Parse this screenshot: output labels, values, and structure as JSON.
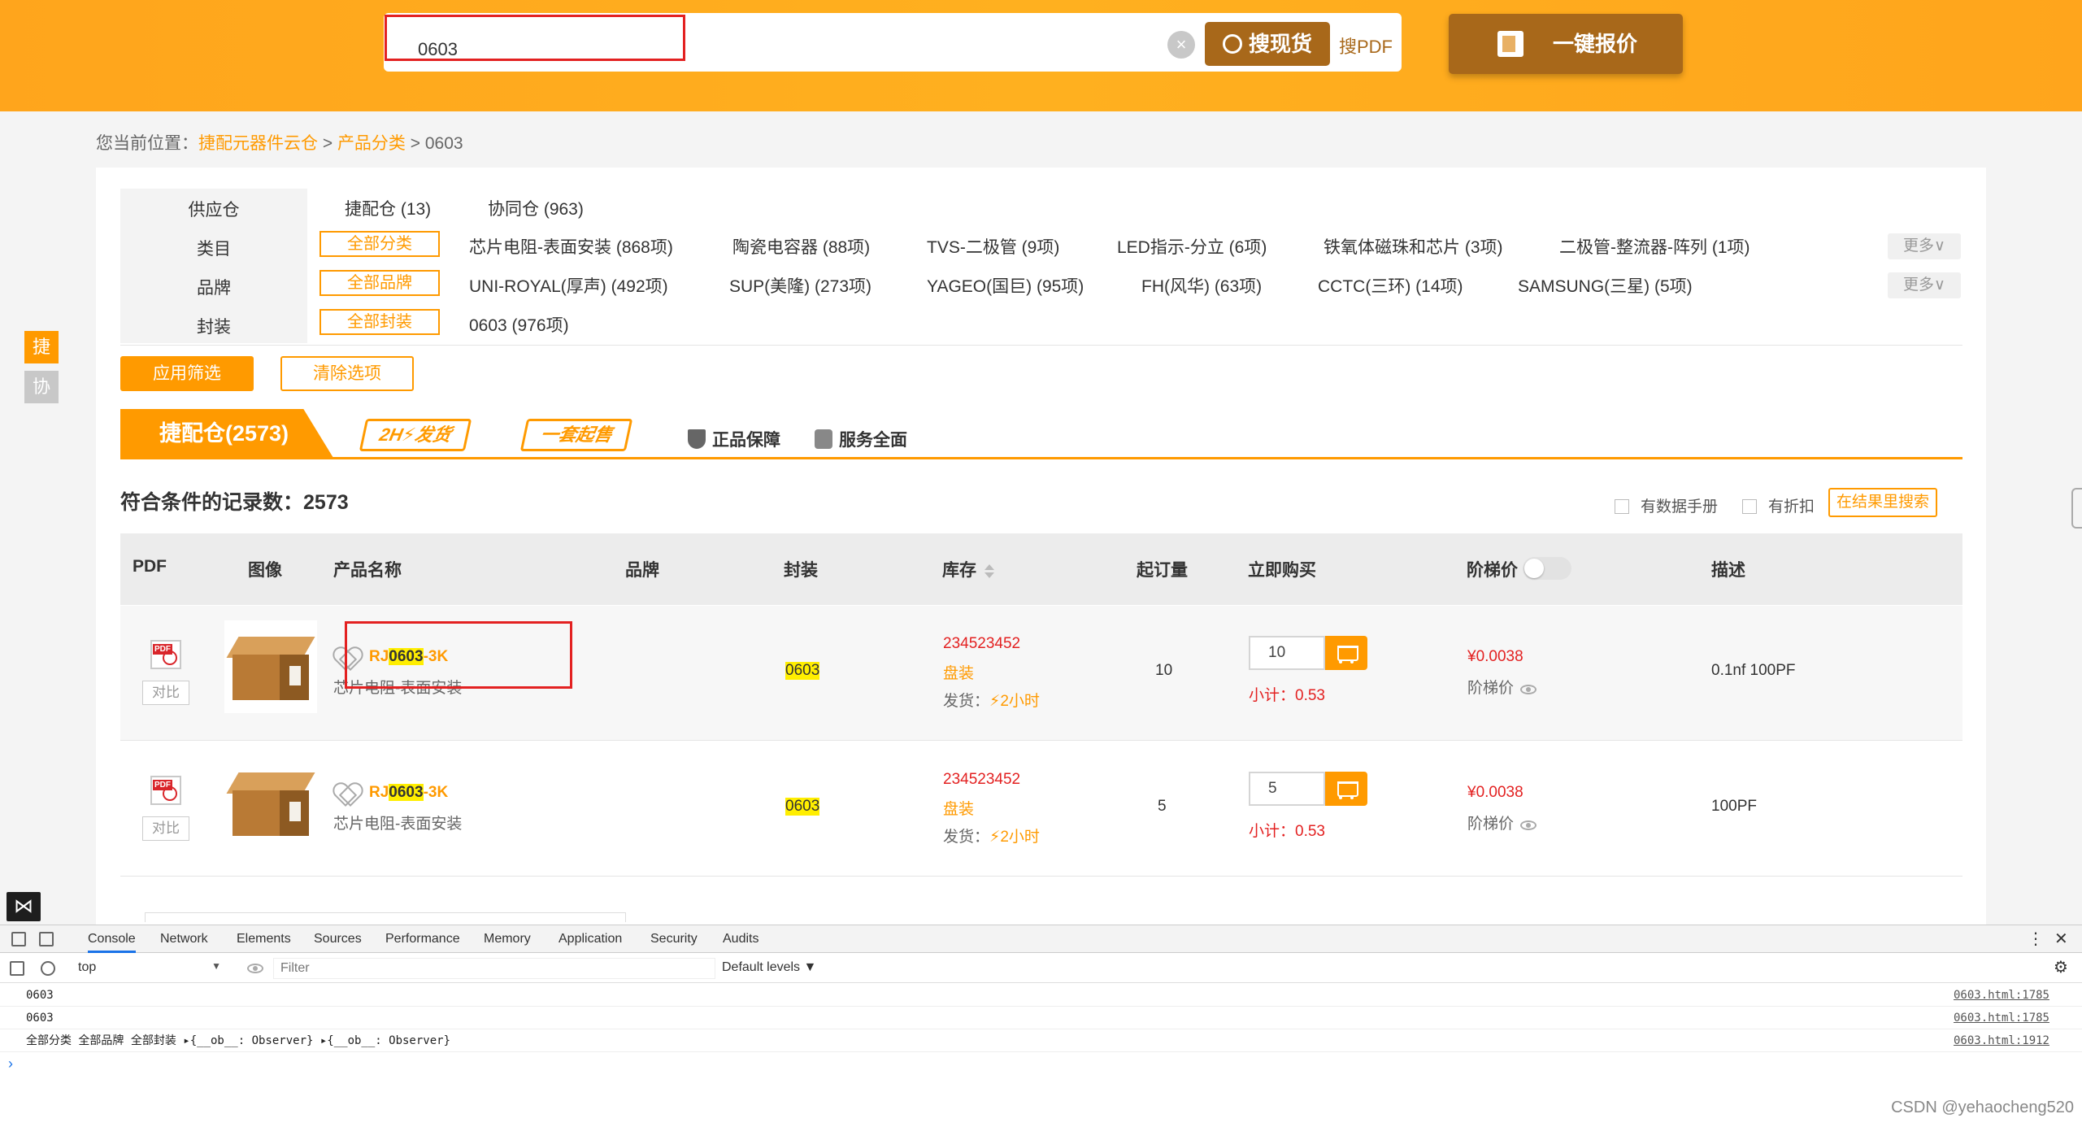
{
  "header": {
    "search_value": "0603",
    "search_btn": "搜现货",
    "pdf_link": "搜PDF",
    "quote_btn": "一键报价",
    "clear_icon": "×"
  },
  "breadcrumb": {
    "prefix": "您当前位置：",
    "home": "捷配元器件云仓",
    "sep1": " > ",
    "category": "产品分类",
    "sep2": " > ",
    "current": "0603"
  },
  "side_tabs": [
    "捷",
    "协"
  ],
  "filters": {
    "labels": [
      "供应仓",
      "类目",
      "品牌",
      "封装"
    ],
    "warehouses": [
      "捷配仓 (13)",
      "协同仓 (963)"
    ],
    "category_all": "全部分类",
    "categories": [
      "芯片电阻-表面安装 (868项)",
      "陶瓷电容器 (88项)",
      "TVS-二极管 (9项)",
      "LED指示-分立 (6项)",
      "铁氧体磁珠和芯片 (3项)",
      "二极管-整流器-阵列 (1项)"
    ],
    "brand_all": "全部品牌",
    "brands": [
      "UNI-ROYAL(厚声) (492项)",
      "SUP(美隆) (273项)",
      "YAGEO(国巨) (95项)",
      "FH(风华) (63项)",
      "CCTC(三环) (14项)",
      "SAMSUNG(三星) (5项)"
    ],
    "package_all": "全部封装",
    "packages": [
      "0603 (976项)"
    ],
    "more": "更多∨",
    "apply": "应用筛选",
    "clear": "清除选项"
  },
  "banner": {
    "tab": "捷配仓(2573)",
    "badge_2h": "2H⚡发货",
    "badge_set": "一套起售",
    "feature1": "正品保障",
    "feature2": "服务全面"
  },
  "result": {
    "count_label": "符合条件的记录数：",
    "count": "2573",
    "chk_datasheet": "有数据手册",
    "chk_discount": "有折扣",
    "search_in_result": "在结果里搜索"
  },
  "table": {
    "headers": [
      "PDF",
      "图像",
      "产品名称",
      "品牌",
      "封装",
      "库存",
      "起订量",
      "立即购买",
      "阶梯价",
      "描述"
    ],
    "rows": [
      {
        "compare": "对比",
        "name_prefix": "RJ",
        "name_hl": "0603",
        "name_suffix": "-3K",
        "category": "芯片电阻-表面安装",
        "package": "0603",
        "stock": "234523452",
        "pack_type": "盘装",
        "ship_label": "发货：",
        "ship_time": "⚡2小时",
        "moq": "10",
        "qty": "10",
        "subtotal_label": "小计：",
        "subtotal": "0.53",
        "price": "¥0.0038",
        "ladder_label": "阶梯价",
        "desc": "0.1nf 100PF"
      },
      {
        "compare": "对比",
        "name_prefix": "RJ",
        "name_hl": "0603",
        "name_suffix": "-3K",
        "category": "芯片电阻-表面安装",
        "package": "0603",
        "stock": "234523452",
        "pack_type": "盘装",
        "ship_label": "发货：",
        "ship_time": "⚡2小时",
        "moq": "5",
        "qty": "5",
        "subtotal_label": "小计：",
        "subtotal": "0.53",
        "price": "¥0.0038",
        "ladder_label": "阶梯价",
        "desc": "100PF"
      }
    ]
  },
  "devtools": {
    "tabs": [
      "Console",
      "Network",
      "Elements",
      "Sources",
      "Performance",
      "Memory",
      "Application",
      "Security",
      "Audits"
    ],
    "context": "top",
    "filter_placeholder": "Filter",
    "levels": "Default levels ▼",
    "logs": [
      {
        "msg": "0603",
        "src": "0603.html:1785"
      },
      {
        "msg": "0603",
        "src": "0603.html:1785"
      },
      {
        "msg": "全部分类 全部品牌 全部封装 ▸{__ob__: Observer} ▸{__ob__: Observer}",
        "src": "0603.html:1912"
      }
    ],
    "prompt": "›"
  },
  "watermark": "CSDN @yehaocheng520",
  "colors": {
    "brand": "#ff9a00",
    "header": "#ffa51c",
    "dark_btn": "#a8681a",
    "price_red": "#e32121",
    "highlight": "#ffee00"
  }
}
